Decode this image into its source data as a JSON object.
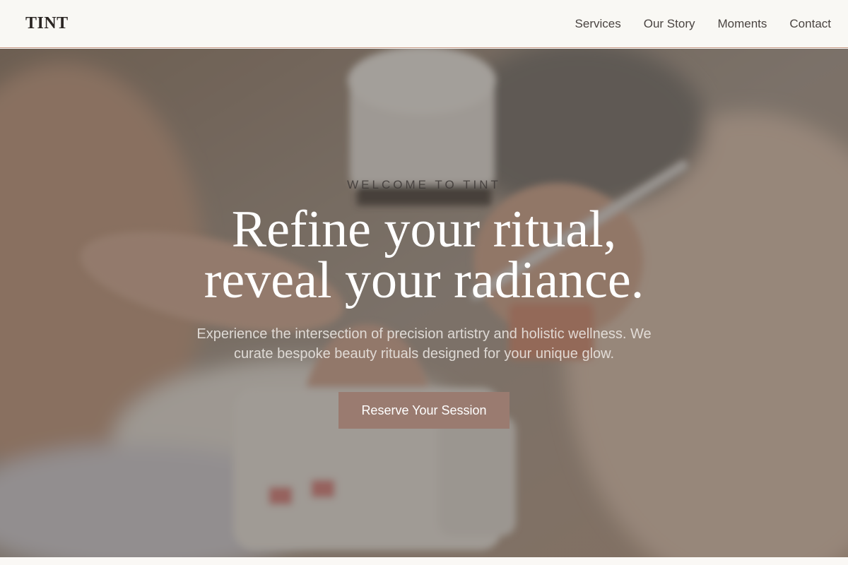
{
  "brand": {
    "name": "TINT"
  },
  "nav": {
    "items": [
      {
        "label": "Services"
      },
      {
        "label": "Our Story"
      },
      {
        "label": "Moments"
      },
      {
        "label": "Contact"
      }
    ]
  },
  "hero": {
    "eyebrow": "Welcome to TINT",
    "headline_line1": "Refine your ritual,",
    "headline_line2": "reveal your radiance.",
    "subtext": "Experience the intersection of precision artistry and holistic wellness. We curate bespoke beauty rituals designed for your unique glow.",
    "cta_label": "Reserve Your Session",
    "background_image": "manicure-session-photo"
  },
  "colors": {
    "header_bg": "#f9f8f4",
    "header_border": "#c89a86",
    "cta_bg": "#9a7b70",
    "headline_text": "#ffffff"
  }
}
